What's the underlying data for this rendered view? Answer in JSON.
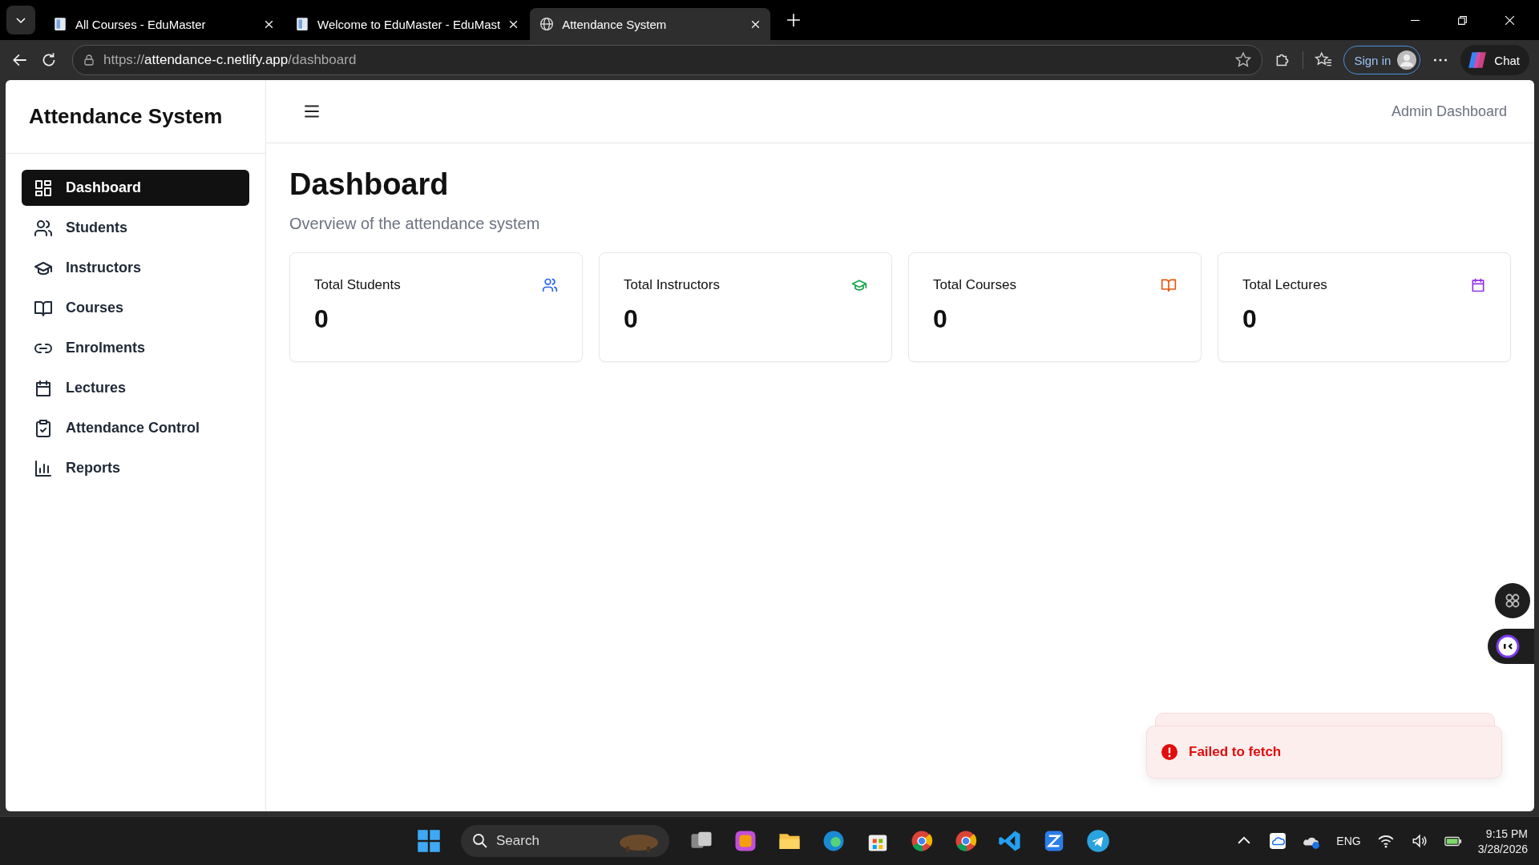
{
  "browser": {
    "tabs": [
      {
        "title": "All Courses - EduMaster",
        "kind": "page",
        "selected": false
      },
      {
        "title": "Welcome to EduMaster - EduMast",
        "kind": "page",
        "selected": false
      },
      {
        "title": "Attendance System",
        "kind": "globe",
        "selected": true
      }
    ],
    "address": {
      "scheme": "https://",
      "host": "attendance-c.netlify.app",
      "path": "/dashboard"
    },
    "sign_in": "Sign in",
    "chat": "Chat"
  },
  "app": {
    "brand": "Attendance System",
    "nav": [
      {
        "label": "Dashboard",
        "kind": "grid",
        "selected": true
      },
      {
        "label": "Students",
        "kind": "users",
        "selected": false
      },
      {
        "label": "Instructors",
        "kind": "cap",
        "selected": false
      },
      {
        "label": "Courses",
        "kind": "book",
        "selected": false
      },
      {
        "label": "Enrolments",
        "kind": "link",
        "selected": false
      },
      {
        "label": "Lectures",
        "kind": "calendar",
        "selected": false
      },
      {
        "label": "Attendance Control",
        "kind": "clipboard",
        "selected": false
      },
      {
        "label": "Reports",
        "kind": "chart",
        "selected": false
      }
    ],
    "header_right": "Admin Dashboard",
    "title": "Dashboard",
    "subtitle": "Overview of the attendance system",
    "stats": [
      {
        "label": "Total Students",
        "value": "0",
        "kind": "users",
        "color": "#2563eb"
      },
      {
        "label": "Total Instructors",
        "value": "0",
        "kind": "cap",
        "color": "#16a34a"
      },
      {
        "label": "Total Courses",
        "value": "0",
        "kind": "book",
        "color": "#ea580c"
      },
      {
        "label": "Total Lectures",
        "value": "0",
        "kind": "calendar",
        "color": "#9333ea"
      }
    ],
    "toast": {
      "kind": "error",
      "message": "Failed to fetch"
    }
  },
  "taskbar": {
    "search": "Search",
    "language": "ENG",
    "time": "9:15 PM",
    "date": "3/28/2026"
  }
}
